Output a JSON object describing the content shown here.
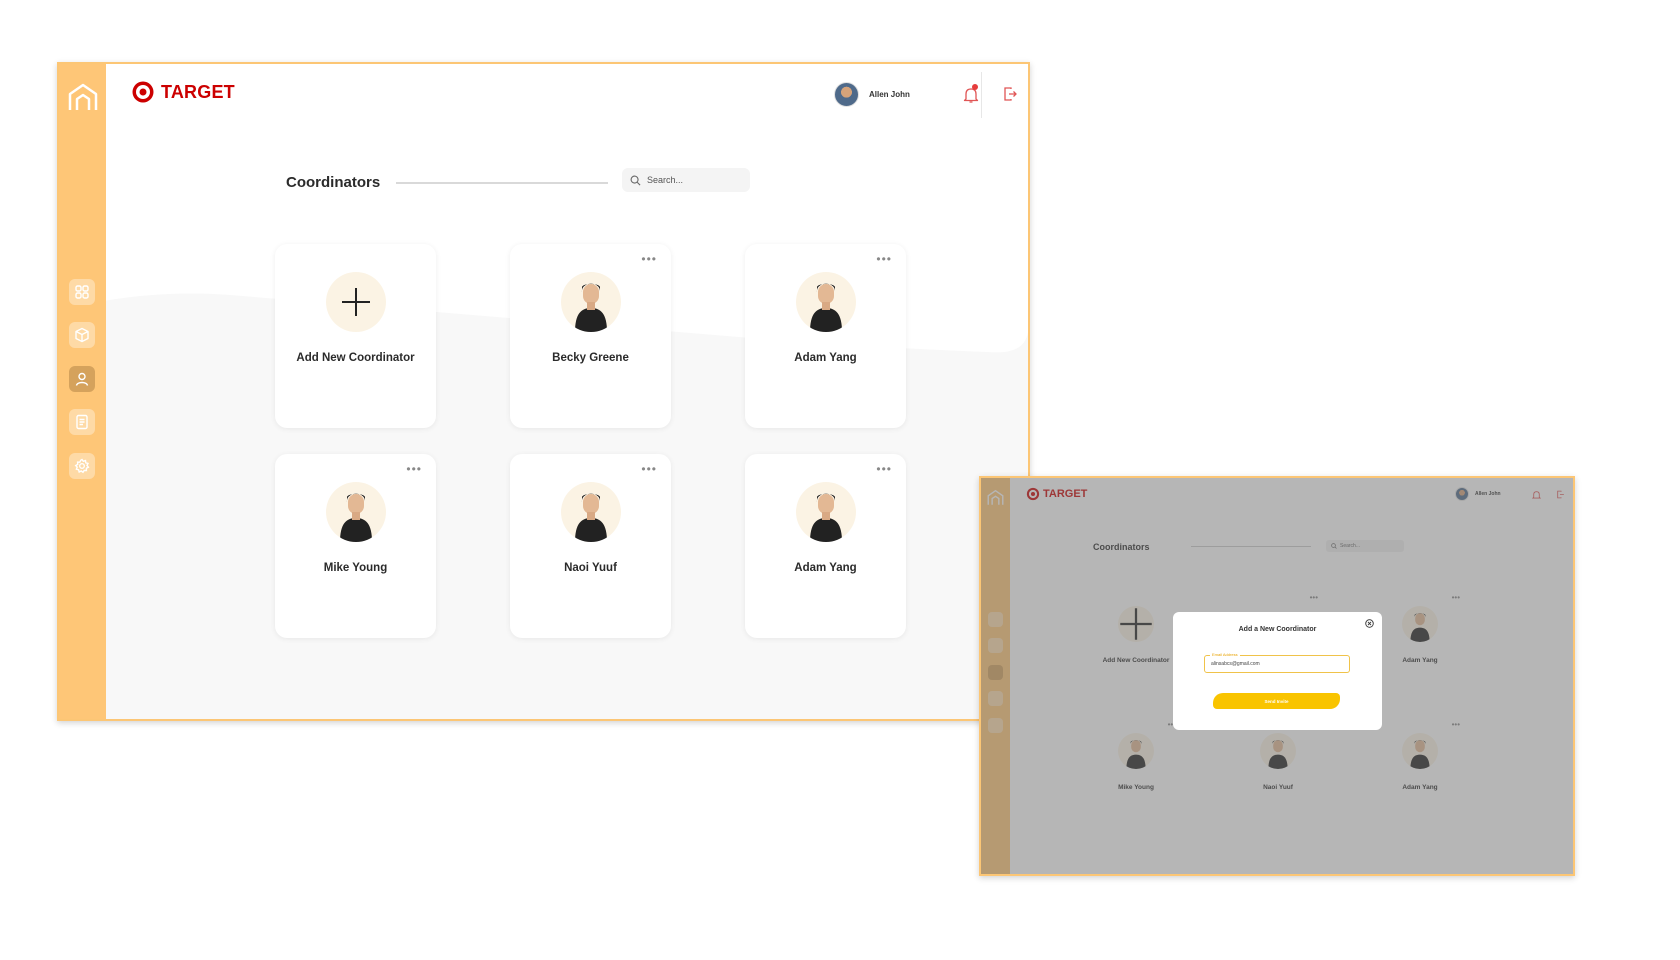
{
  "brand": {
    "name": "TARGET",
    "color": "#cc0000"
  },
  "user": {
    "name": "Allen John"
  },
  "page": {
    "title": "Coordinators"
  },
  "search": {
    "placeholder": "Search..."
  },
  "sidebar": {
    "items": [
      "dashboard-icon",
      "box-icon",
      "user-icon",
      "document-icon",
      "settings-icon"
    ],
    "active": "user-icon",
    "color": "#fec677"
  },
  "cards": {
    "add_label": "Add New Coordinator",
    "items": [
      {
        "name": "Becky Greene"
      },
      {
        "name": "Adam Yang"
      },
      {
        "name": "Mike Young"
      },
      {
        "name": "Naoi Yuuf"
      },
      {
        "name": "Adam Yang"
      }
    ]
  },
  "modal": {
    "title": "Add a New Coordinator",
    "field_label": "Email Address",
    "field_value": "alinsabcs@gmail.com",
    "button_label": "Send Invite"
  }
}
